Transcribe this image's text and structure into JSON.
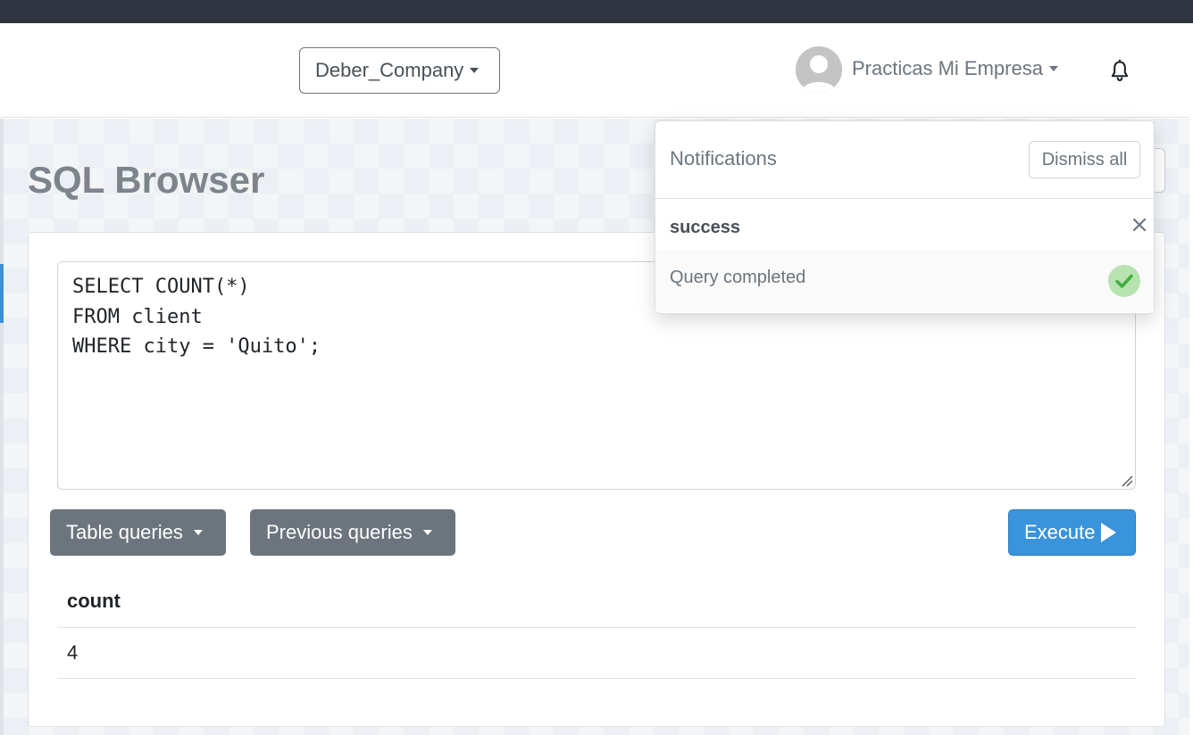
{
  "navbar": {
    "company_selector": "Deber_Company",
    "user_name": "Practicas Mi Empresa"
  },
  "page": {
    "title": "SQL Browser"
  },
  "editor": {
    "query": "SELECT COUNT(*)\nFROM client\nWHERE city = 'Quito';"
  },
  "toolbar": {
    "table_queries_label": "Table queries",
    "previous_queries_label": "Previous queries",
    "execute_label": "Execute"
  },
  "results": {
    "columns": [
      "count"
    ],
    "rows": [
      [
        "4"
      ]
    ]
  },
  "notifications": {
    "title": "Notifications",
    "dismiss_all_label": "Dismiss all",
    "items": [
      {
        "type": "success",
        "message": "Query completed"
      }
    ]
  },
  "colors": {
    "top_strip": "#2e3440",
    "execute_button": "#3a94dc",
    "secondary_button": "#6c757d",
    "success_check": "#4caf50"
  },
  "icons": {
    "bell": "bell-icon",
    "avatar": "user-avatar-icon",
    "check": "check-icon",
    "close": "close-icon",
    "play": "play-icon"
  }
}
